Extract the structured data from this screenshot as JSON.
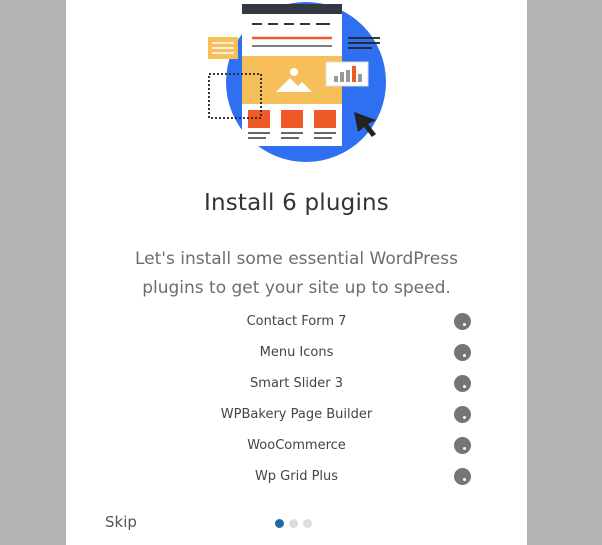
{
  "step": {
    "title": "Install 6 plugins",
    "description": "Let's install some essential WordPress plugins to get your site up to speed."
  },
  "plugins": [
    {
      "name": "Contact Form 7",
      "icon": "pending-status-icon"
    },
    {
      "name": "Menu Icons",
      "icon": "pending-status-icon"
    },
    {
      "name": "Smart Slider 3",
      "icon": "pending-status-icon"
    },
    {
      "name": "WPBakery Page Builder",
      "icon": "pending-status-icon"
    },
    {
      "name": "WooCommerce",
      "icon": "pending-status-icon"
    },
    {
      "name": "Wp Grid Plus",
      "icon": "pending-status-icon"
    }
  ],
  "footer": {
    "skip_label": "Skip",
    "pagination": {
      "total": 3,
      "active_index": 1
    }
  },
  "colors": {
    "backdrop": "#b3b3b3",
    "panel": "#ffffff",
    "illustration_circle": "#2f6ff2",
    "illustration_accent": "#f6bf5a",
    "illustration_red": "#f05a28",
    "status_icon": "#757575",
    "dot_active": "#1e6aa8",
    "dot_inactive": "#dddddd"
  }
}
